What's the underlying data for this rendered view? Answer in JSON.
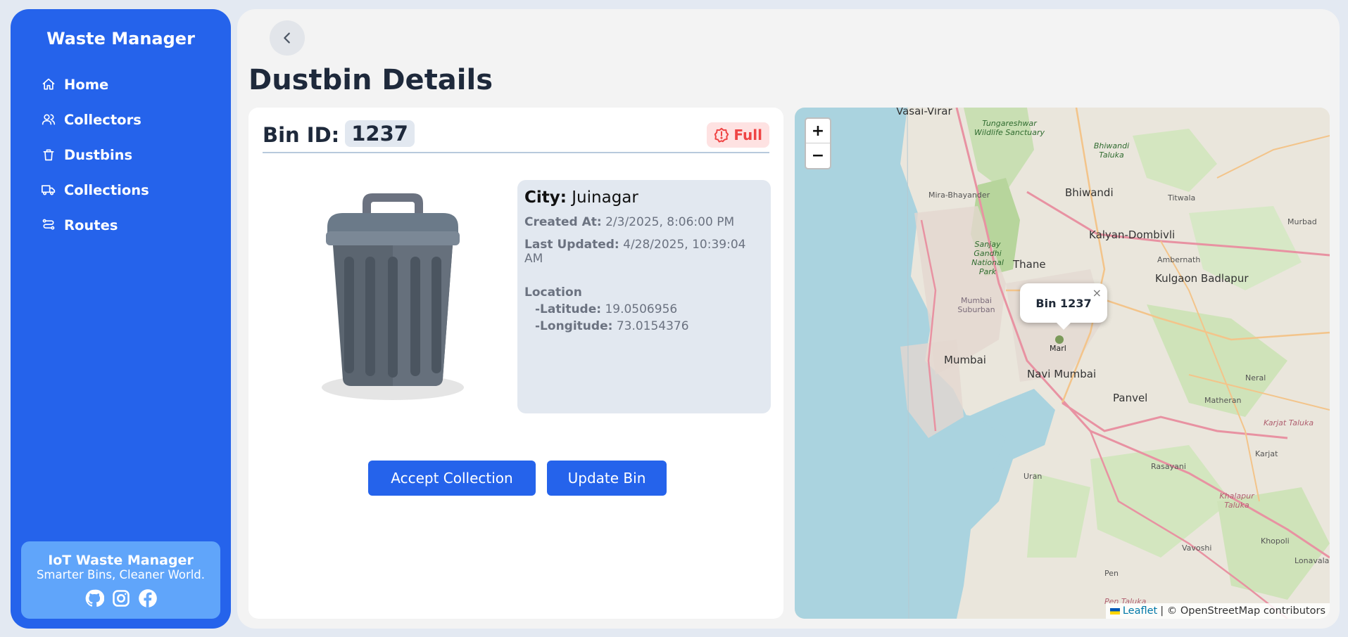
{
  "sidebar": {
    "brand": "Waste Manager",
    "items": [
      {
        "label": "Home",
        "icon": "home-icon"
      },
      {
        "label": "Collectors",
        "icon": "users-icon"
      },
      {
        "label": "Dustbins",
        "icon": "trash-icon"
      },
      {
        "label": "Collections",
        "icon": "truck-icon"
      },
      {
        "label": "Routes",
        "icon": "route-icon"
      }
    ],
    "footer": {
      "title": "IoT Waste Manager",
      "subtitle": "Smarter Bins, Cleaner World.",
      "socials": [
        "github-icon",
        "instagram-icon",
        "facebook-icon"
      ]
    }
  },
  "page": {
    "title": "Dustbin Details"
  },
  "bin": {
    "id_label": "Bin ID:",
    "id": "1237",
    "status": "Full",
    "city_label": "City:",
    "city": "Juinagar",
    "created_label": "Created At:",
    "created_at": "2/3/2025, 8:06:00 PM",
    "updated_label": "Last Updated:",
    "updated_at": "4/28/2025, 10:39:04 AM",
    "location_label": "Location",
    "latitude_label": "-Latitude:",
    "latitude": "19.0506956",
    "longitude_label": "-Longitude:",
    "longitude": "73.0154376"
  },
  "actions": {
    "accept": "Accept Collection",
    "update": "Update Bin"
  },
  "map": {
    "zoom_in": "+",
    "zoom_out": "−",
    "popup": "Bin 1237",
    "popup_close": "×",
    "leaflet": "Leaflet",
    "attribution": "| © OpenStreetMap contributors",
    "places": {
      "vasai": "Vasai-Virar",
      "tungareshwar": "Tungareshwar Wildlife Sanctuary",
      "bhiwandi_taluka": "Bhiwandi Taluka",
      "mira": "Mira-Bhayander",
      "bhiwandi": "Bhiwandi",
      "titwala": "Titwala",
      "murbad": "Murbad",
      "kalyan": "Kalyan-Dombivli",
      "sanjay": "Sanjay Gandhi National Park",
      "thane": "Thane",
      "ambernath": "Ambernath",
      "kulgaon": "Kulgaon Badlapur",
      "mumbai_suburban": "Mumbai Suburban",
      "marl": "Marl",
      "mumbai": "Mumbai",
      "navi_mumbai": "Navi Mumbai",
      "neral": "Neral",
      "panvel": "Panvel",
      "matheran": "Matheran",
      "karjat_taluka": "Karjat Taluka",
      "karjat": "Karjat",
      "uran": "Uran",
      "rasayani": "Rasayani",
      "khalapur": "Khalapur Taluka",
      "vavoshi": "Vavoshi",
      "khopoli": "Khopoli",
      "pen": "Pen",
      "lonavala": "Lonavala",
      "pen_taluka": "Pen Taluka"
    }
  },
  "colors": {
    "primary": "#2563eb",
    "sidebar_footer": "#60a5fa",
    "danger": "#ef4444",
    "danger_bg": "#fee2e2",
    "panel": "#e2e8f0"
  }
}
